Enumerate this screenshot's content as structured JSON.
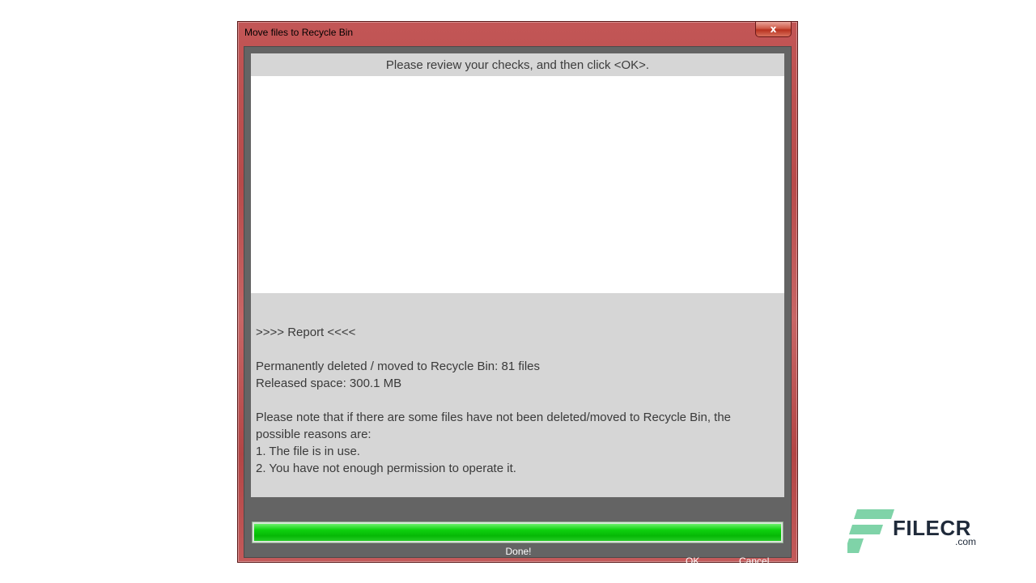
{
  "window": {
    "title": "Move files to Recycle Bin",
    "close_glyph": "x"
  },
  "list": {
    "header": "Please review your checks, and then click <OK>."
  },
  "report": {
    "heading": ">>>> Report <<<<",
    "deleted": "Permanently deleted / moved to Recycle Bin: 81 files",
    "released": "Released space: 300.1 MB",
    "note_line1": "Please note that if there are some files have not been deleted/moved to Recycle Bin, the",
    "note_line2": "possible reasons are:",
    "reason1": "1. The file is in use.",
    "reason2": "2. You have not enough permission to operate it."
  },
  "progress": {
    "percent": 100,
    "status": "Done!"
  },
  "buttons": {
    "ok": "OK",
    "cancel": "Cancel"
  },
  "watermark": {
    "brand": "FILECR",
    "domain": ".com",
    "colors": {
      "mark": "#7fd3a8",
      "text": "#1f2a3a"
    }
  },
  "colors": {
    "frame": "#b84a4a",
    "client": "#646464",
    "panel": "#d6d6d6",
    "progress": "#0fd10f"
  }
}
